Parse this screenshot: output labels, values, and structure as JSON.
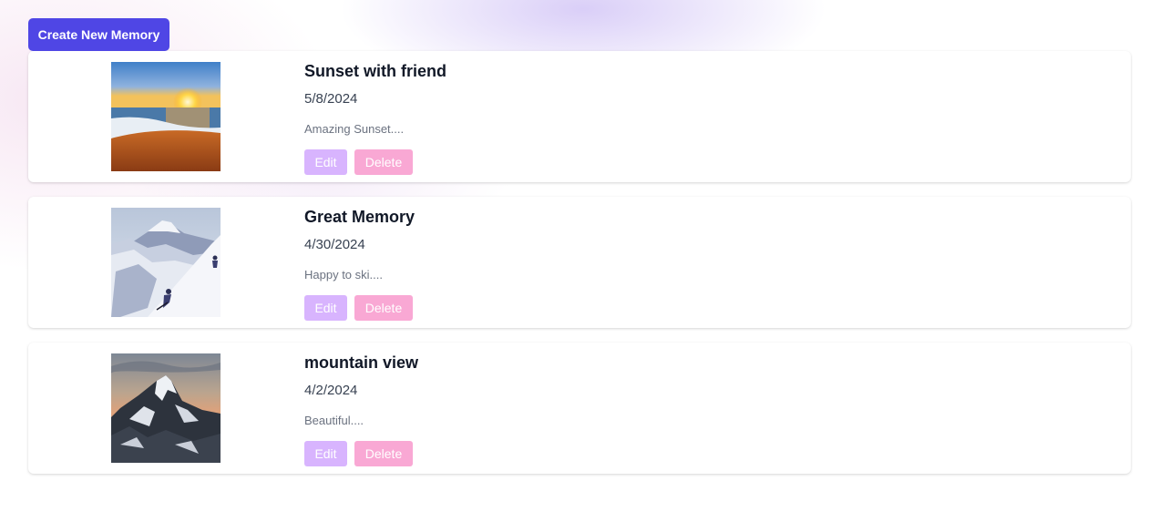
{
  "toolbar": {
    "create_label": "Create New Memory"
  },
  "memories": [
    {
      "title": "Sunset with friend",
      "date": "5/8/2024",
      "description": "Amazing Sunset....",
      "edit_label": "Edit",
      "delete_label": "Delete",
      "image": "sunset-beach-image"
    },
    {
      "title": "Great Memory",
      "date": "4/30/2024",
      "description": "Happy to ski....",
      "edit_label": "Edit",
      "delete_label": "Delete",
      "image": "ski-mountain-image"
    },
    {
      "title": "mountain view",
      "date": "4/2/2024",
      "description": "Beautiful....",
      "edit_label": "Edit",
      "delete_label": "Delete",
      "image": "mountain-peak-image"
    }
  ],
  "colors": {
    "primary": "#4f46e5",
    "edit": "#d8b4fe",
    "delete": "#f9a8d4"
  }
}
